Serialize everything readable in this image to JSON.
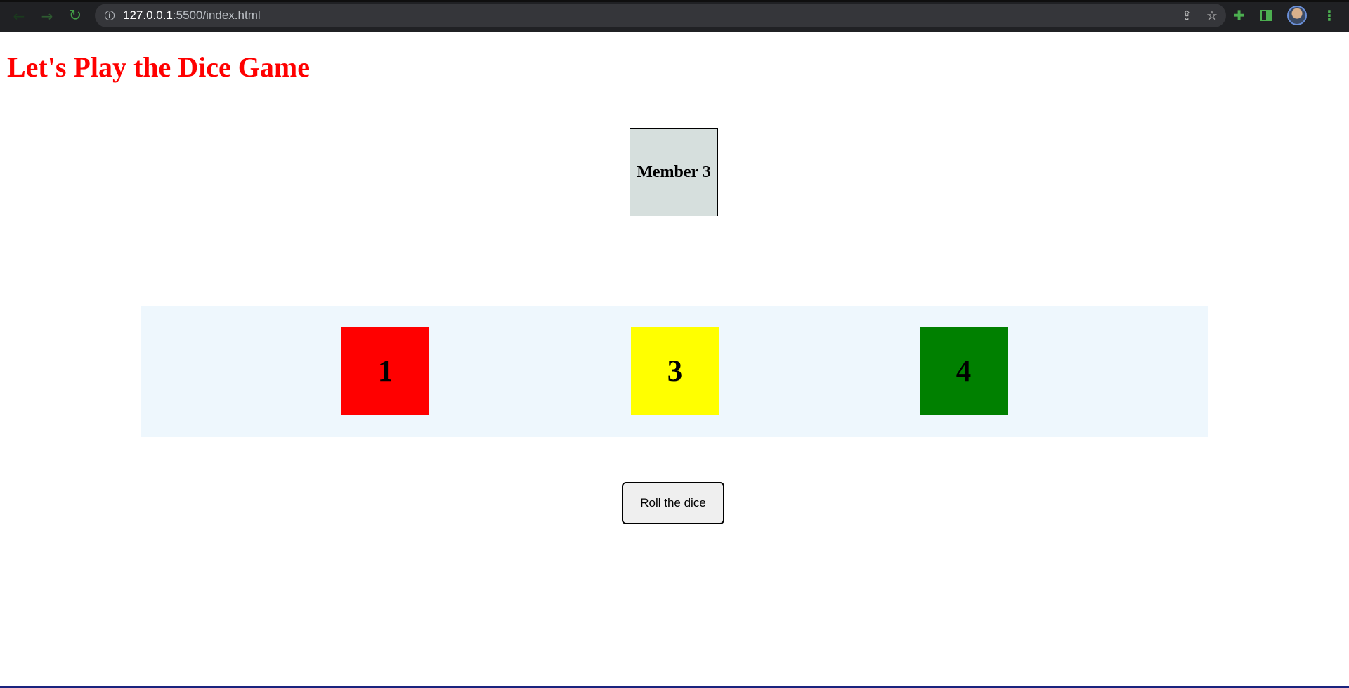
{
  "browser": {
    "url_host": "127.0.0.1",
    "url_path": ":5500/index.html",
    "back_glyph": "←",
    "forward_glyph": "→",
    "reload_glyph": "↻",
    "info_glyph": "i",
    "share_glyph": "⇪",
    "star_glyph": "☆",
    "extensions_glyph": "✚",
    "menu_glyph": "⋮"
  },
  "page": {
    "title": "Let's Play the Dice Game",
    "member_label": "Member 3",
    "roll_button_label": "Roll the dice"
  },
  "dice": [
    {
      "value": "1",
      "color": "#ff0000"
    },
    {
      "value": "3",
      "color": "#ffff00"
    },
    {
      "value": "4",
      "color": "#008000"
    }
  ],
  "colors": {
    "title": "#ff0000",
    "member_box_bg": "#d6dfdd",
    "dice_area_bg": "#eef7fd",
    "chrome_accent": "#4caf50"
  }
}
